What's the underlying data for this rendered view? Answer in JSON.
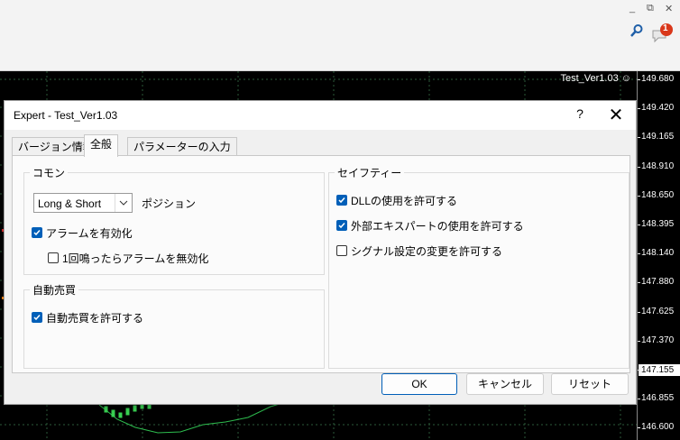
{
  "window": {
    "minimize_glyph": "_",
    "restore_glyph": "⧉",
    "close_glyph": "✕"
  },
  "toolbar": {
    "search_icon": "search-icon",
    "notifications_icon": "notifications-icon",
    "notification_count": "1"
  },
  "chart": {
    "title": "Test_Ver1.03",
    "title_icon": "☺",
    "price_ticks": [
      "149.680",
      "149.420",
      "149.165",
      "148.910",
      "148.650",
      "148.395",
      "148.140",
      "147.880",
      "147.625",
      "147.370",
      "147.155",
      "146.855",
      "146.600"
    ],
    "current_price": "147.155",
    "colors": {
      "background": "#000000",
      "grid": "#1e4a2a",
      "line": "#2ebd4f",
      "candle_up": "#39d353"
    }
  },
  "dialog": {
    "title": "Expert - Test_Ver1.03",
    "help_label": "?",
    "close_label": "✕",
    "tabs": [
      {
        "label": "バージョン情報",
        "active": false
      },
      {
        "label": "全般",
        "active": true
      },
      {
        "label": "パラメーターの入力",
        "active": false
      }
    ],
    "common": {
      "title": "コモン",
      "position_select": {
        "value": "Long & Short"
      },
      "position_label": "ポジション",
      "enable_alert": {
        "label": "アラームを有効化",
        "checked": true
      },
      "disable_after_one": {
        "label": "1回鳴ったらアラームを無効化",
        "checked": false
      }
    },
    "auto_trading": {
      "title": "自動売買",
      "allow_auto_trading": {
        "label": "自動売買を許可する",
        "checked": true
      }
    },
    "safety": {
      "title": "セイフティー",
      "allow_dll": {
        "label": "DLLの使用を許可する",
        "checked": true
      },
      "allow_external_experts": {
        "label": "外部エキスパートの使用を許可する",
        "checked": true
      },
      "allow_signal_settings": {
        "label": "シグナル設定の変更を許可する",
        "checked": false
      }
    },
    "buttons": {
      "ok": "OK",
      "cancel": "キャンセル",
      "reset": "リセット"
    },
    "accent_color": "#005fb8"
  }
}
